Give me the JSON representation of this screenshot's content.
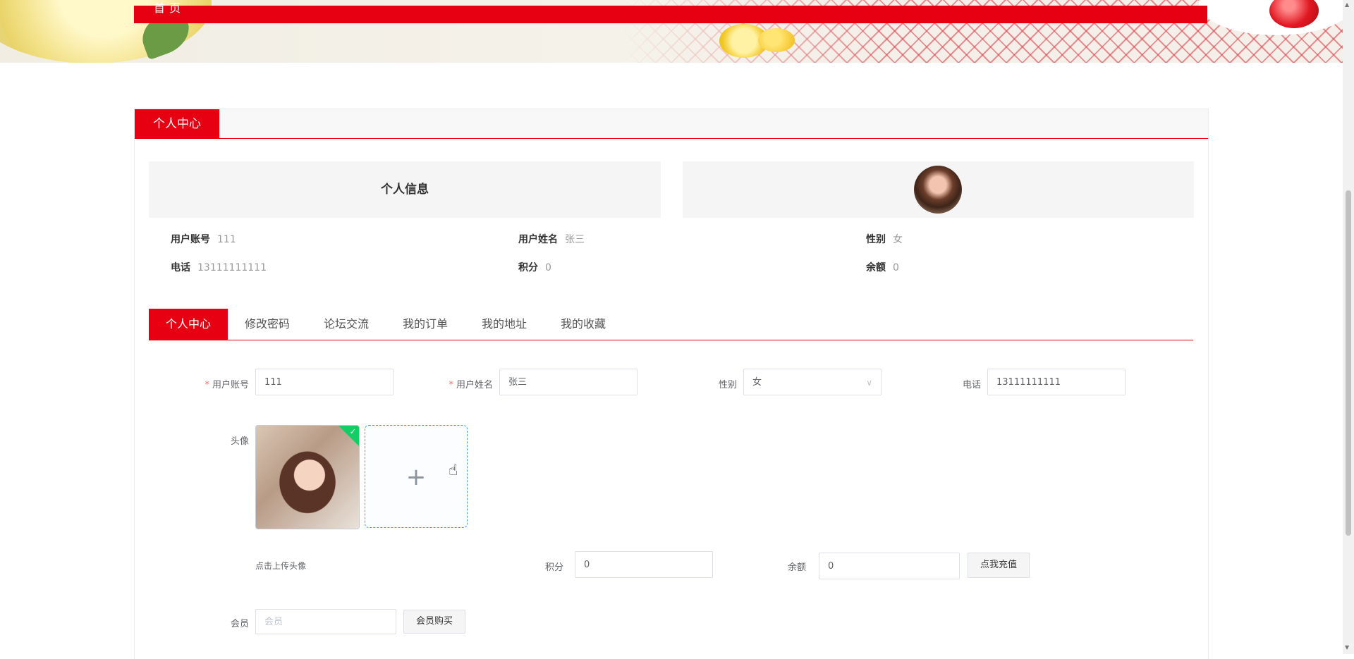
{
  "nav": {
    "home_label": "首页"
  },
  "page": {
    "title": "个人中心"
  },
  "profile": {
    "heading": "个人信息",
    "fields": [
      {
        "key": "用户账号",
        "value": "111"
      },
      {
        "key": "用户姓名",
        "value": "张三"
      },
      {
        "key": "性别",
        "value": "女"
      },
      {
        "key": "电话",
        "value": "13111111111"
      },
      {
        "key": "积分",
        "value": "0"
      },
      {
        "key": "余额",
        "value": "0"
      }
    ]
  },
  "tabs": [
    "个人中心",
    "修改密码",
    "论坛交流",
    "我的订单",
    "我的地址",
    "我的收藏"
  ],
  "form": {
    "account_label": "用户账号",
    "account_value": "111",
    "name_label": "用户姓名",
    "name_value": "张三",
    "gender_label": "性别",
    "gender_value": "女",
    "phone_label": "电话",
    "phone_value": "13111111111",
    "avatar_label": "头像",
    "upload_hint": "点击上传头像",
    "points_label": "积分",
    "points_value": "0",
    "balance_label": "余额",
    "balance_value": "0",
    "recharge_button": "点我充值",
    "member_label": "会员",
    "member_placeholder": "会员",
    "member_buy_button": "会员购买"
  }
}
